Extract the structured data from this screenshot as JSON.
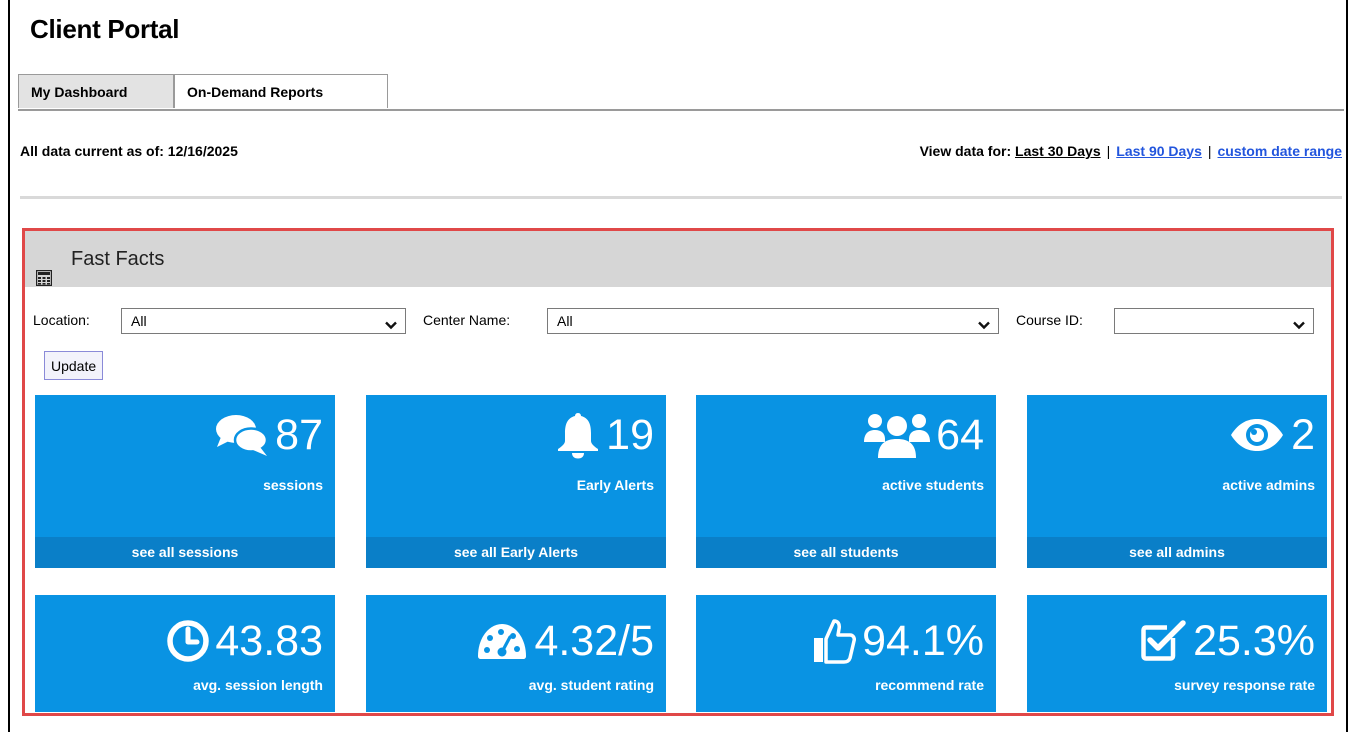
{
  "app": {
    "title": "Client Portal"
  },
  "tabs": [
    {
      "label": "My Dashboard",
      "active": true
    },
    {
      "label": "On-Demand Reports",
      "active": false
    }
  ],
  "status": {
    "as_of_label": "All data current as of: 12/16/2025"
  },
  "view_for": {
    "label": "View data for:",
    "options": [
      "Last 30 Days",
      "Last 90 Days",
      "custom date range"
    ],
    "selected": "Last 30 Days",
    "separator": "|"
  },
  "panel": {
    "title": "Fast Facts",
    "icon": "calculator-icon"
  },
  "filters": {
    "location": {
      "label": "Location:",
      "value": "All"
    },
    "center": {
      "label": "Center Name:",
      "value": "All"
    },
    "course": {
      "label": "Course ID:",
      "value": ""
    },
    "update_label": "Update"
  },
  "tiles": [
    {
      "icon": "comments-icon",
      "value": "87",
      "label": "sessions",
      "link": "see all sessions"
    },
    {
      "icon": "bell-icon",
      "value": "19",
      "label": "Early Alerts",
      "link": "see all Early Alerts"
    },
    {
      "icon": "users-icon",
      "value": "64",
      "label": "active students",
      "link": "see all students"
    },
    {
      "icon": "eye-icon",
      "value": "2",
      "label": "active admins",
      "link": "see all admins"
    },
    {
      "icon": "clock-icon",
      "value": "43.83",
      "label": "avg. session length"
    },
    {
      "icon": "dashboard-icon",
      "value": "4.32/5",
      "label": "avg. student rating"
    },
    {
      "icon": "thumbs-up-icon",
      "value": "94.1%",
      "label": "recommend rate"
    },
    {
      "icon": "checkbox-icon",
      "value": "25.3%",
      "label": "survey response rate"
    }
  ],
  "colors": {
    "tile": "#0993e3",
    "tile_footer": "#0a7fc8",
    "panel_border": "#e04848",
    "link": "#2255dd"
  }
}
